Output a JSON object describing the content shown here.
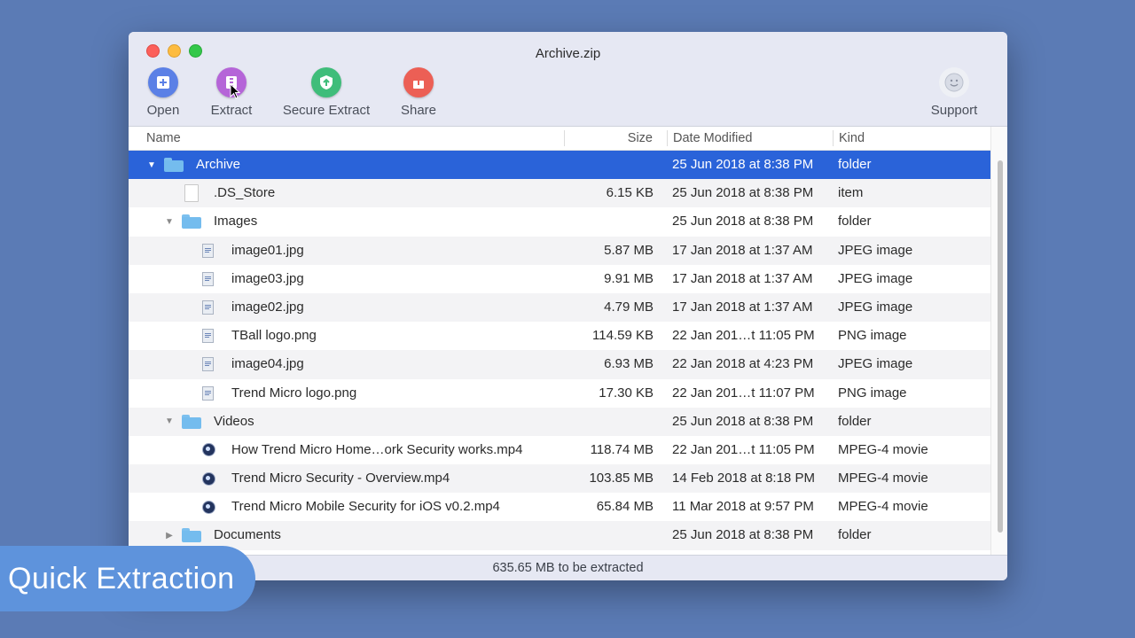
{
  "window": {
    "title": "Archive.zip"
  },
  "toolbar": {
    "open": {
      "label": "Open",
      "icon": "open-icon"
    },
    "extract": {
      "label": "Extract",
      "icon": "extract-icon"
    },
    "secure_extract": {
      "label": "Secure Extract",
      "icon": "shield-icon"
    },
    "share": {
      "label": "Share",
      "icon": "share-icon"
    },
    "support": {
      "label": "Support",
      "icon": "smiley-icon"
    }
  },
  "columns": {
    "name": "Name",
    "size": "Size",
    "date": "Date Modified",
    "kind": "Kind"
  },
  "rows": [
    {
      "name": "Archive",
      "size": "",
      "date": "25 Jun 2018 at 8:38 PM",
      "kind": "folder",
      "icon": "folder",
      "disclosure": "expanded",
      "selected": true
    },
    {
      "name": ".DS_Store",
      "size": "6.15 KB",
      "date": "25 Jun 2018 at 8:38 PM",
      "kind": "item",
      "icon": "doc"
    },
    {
      "name": "Images",
      "size": "",
      "date": "25 Jun 2018 at 8:38 PM",
      "kind": "folder",
      "icon": "folder",
      "disclosure": "expanded"
    },
    {
      "name": "image01.jpg",
      "size": "5.87 MB",
      "date": "17 Jan 2018 at 1:37 AM",
      "kind": "JPEG image",
      "icon": "image"
    },
    {
      "name": "image03.jpg",
      "size": "9.91 MB",
      "date": "17 Jan 2018 at 1:37 AM",
      "kind": "JPEG image",
      "icon": "image"
    },
    {
      "name": "image02.jpg",
      "size": "4.79 MB",
      "date": "17 Jan 2018 at 1:37 AM",
      "kind": "JPEG image",
      "icon": "image"
    },
    {
      "name": "TBall logo.png",
      "size": "114.59 KB",
      "date": "22 Jan 201…t 11:05 PM",
      "kind": "PNG image",
      "icon": "image"
    },
    {
      "name": "image04.jpg",
      "size": "6.93 MB",
      "date": "22 Jan 2018 at 4:23 PM",
      "kind": "JPEG image",
      "icon": "image"
    },
    {
      "name": "Trend Micro logo.png",
      "size": "17.30 KB",
      "date": "22 Jan 201…t 11:07 PM",
      "kind": "PNG image",
      "icon": "image"
    },
    {
      "name": "Videos",
      "size": "",
      "date": "25 Jun 2018 at 8:38 PM",
      "kind": "folder",
      "icon": "folder",
      "disclosure": "expanded"
    },
    {
      "name": "How Trend Micro Home…ork Security works.mp4",
      "size": "118.74 MB",
      "date": "22 Jan 201…t 11:05 PM",
      "kind": "MPEG-4 movie",
      "icon": "video"
    },
    {
      "name": "Trend Micro Security - Overview.mp4",
      "size": "103.85 MB",
      "date": "14 Feb 2018 at 8:18 PM",
      "kind": "MPEG-4 movie",
      "icon": "video"
    },
    {
      "name": "Trend Micro Mobile Security for iOS v0.2.mp4",
      "size": "65.84 MB",
      "date": "11 Mar 2018 at 9:57 PM",
      "kind": "MPEG-4 movie",
      "icon": "video"
    },
    {
      "name": "Documents",
      "size": "",
      "date": "25 Jun 2018 at 8:38 PM",
      "kind": "folder",
      "icon": "folder",
      "disclosure": "collapsed"
    }
  ],
  "status": {
    "text": "635.65 MB to be extracted"
  },
  "caption": {
    "text": "Quick Extraction"
  },
  "colors": {
    "selection": "#2a63d9",
    "background": "#5b7bb5",
    "caption": "#5e93dc"
  }
}
